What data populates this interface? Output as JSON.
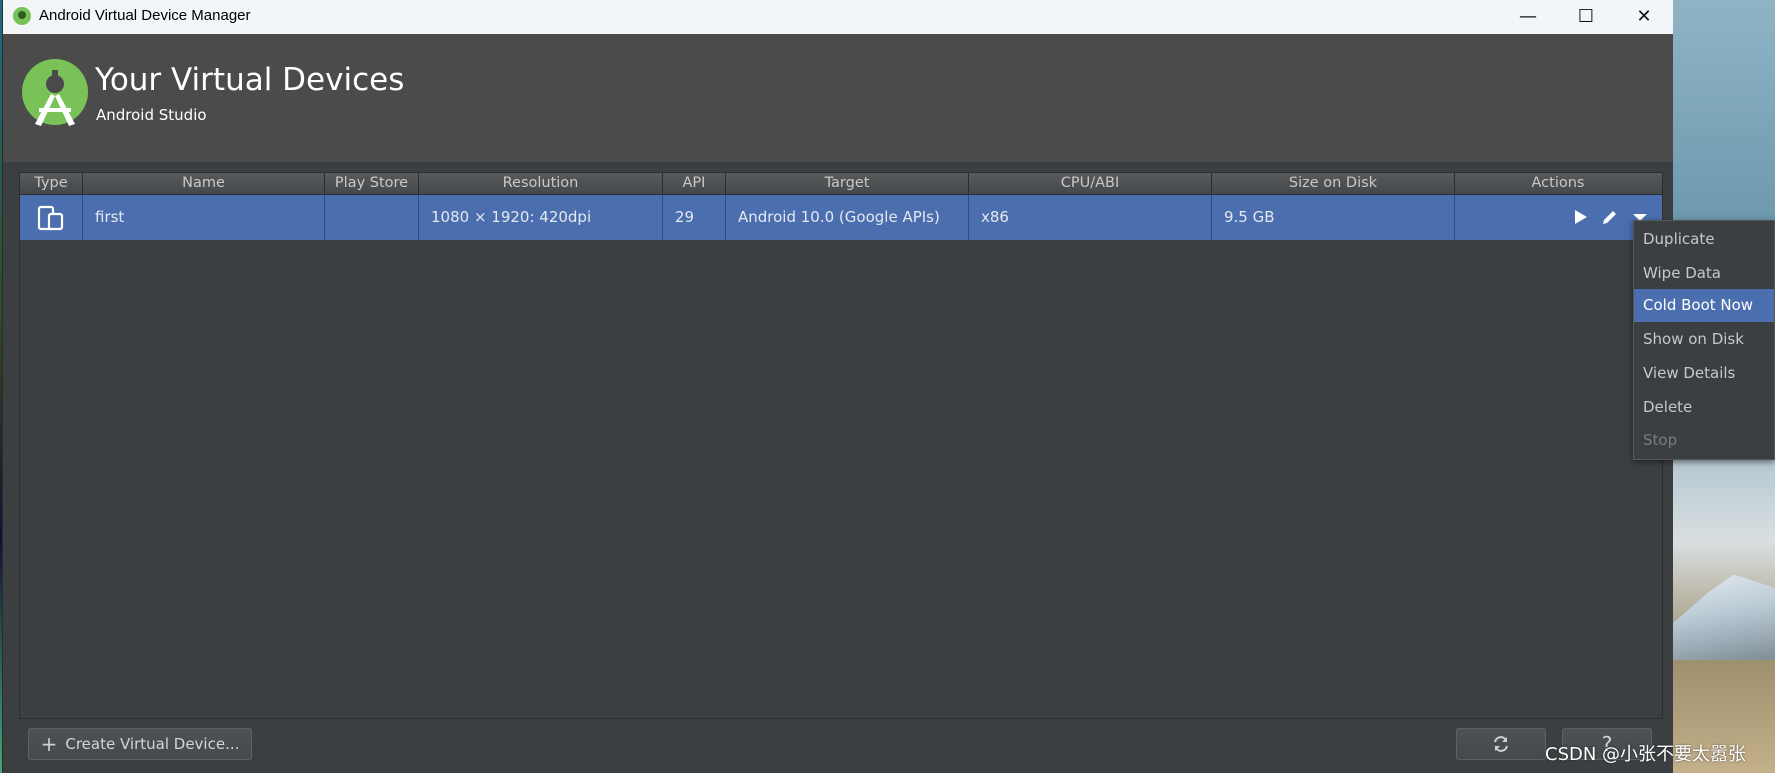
{
  "window": {
    "title": "Android Virtual Device Manager",
    "minimize": "—",
    "maximize": "☐",
    "close": "✕"
  },
  "header": {
    "title": "Your Virtual Devices",
    "subtitle": "Android Studio"
  },
  "table": {
    "columns": [
      "Type",
      "Name",
      "Play Store",
      "Resolution",
      "API",
      "Target",
      "CPU/ABI",
      "Size on Disk",
      "Actions"
    ],
    "rows": [
      {
        "type_icon": "phone-tablet-icon",
        "name": "first",
        "play_store": "",
        "resolution": "1080 × 1920: 420dpi",
        "api": "29",
        "target": "Android 10.0 (Google APIs)",
        "cpu_abi": "x86",
        "size_on_disk": "9.5 GB"
      }
    ]
  },
  "menu": {
    "items": [
      "Duplicate",
      "Wipe Data",
      "Cold Boot Now",
      "Show on Disk",
      "View Details",
      "Delete",
      "Stop"
    ],
    "selected": "Cold Boot Now",
    "disabled": "Stop"
  },
  "footer": {
    "create_label": "Create Virtual Device...",
    "help_label": "?"
  },
  "watermark": "CSDN @小张不要太嚣张",
  "colors": {
    "selection": "#4b6eaf",
    "background": "#3c3f41",
    "header": "#4b4b4b",
    "android_green": "#78c257"
  }
}
